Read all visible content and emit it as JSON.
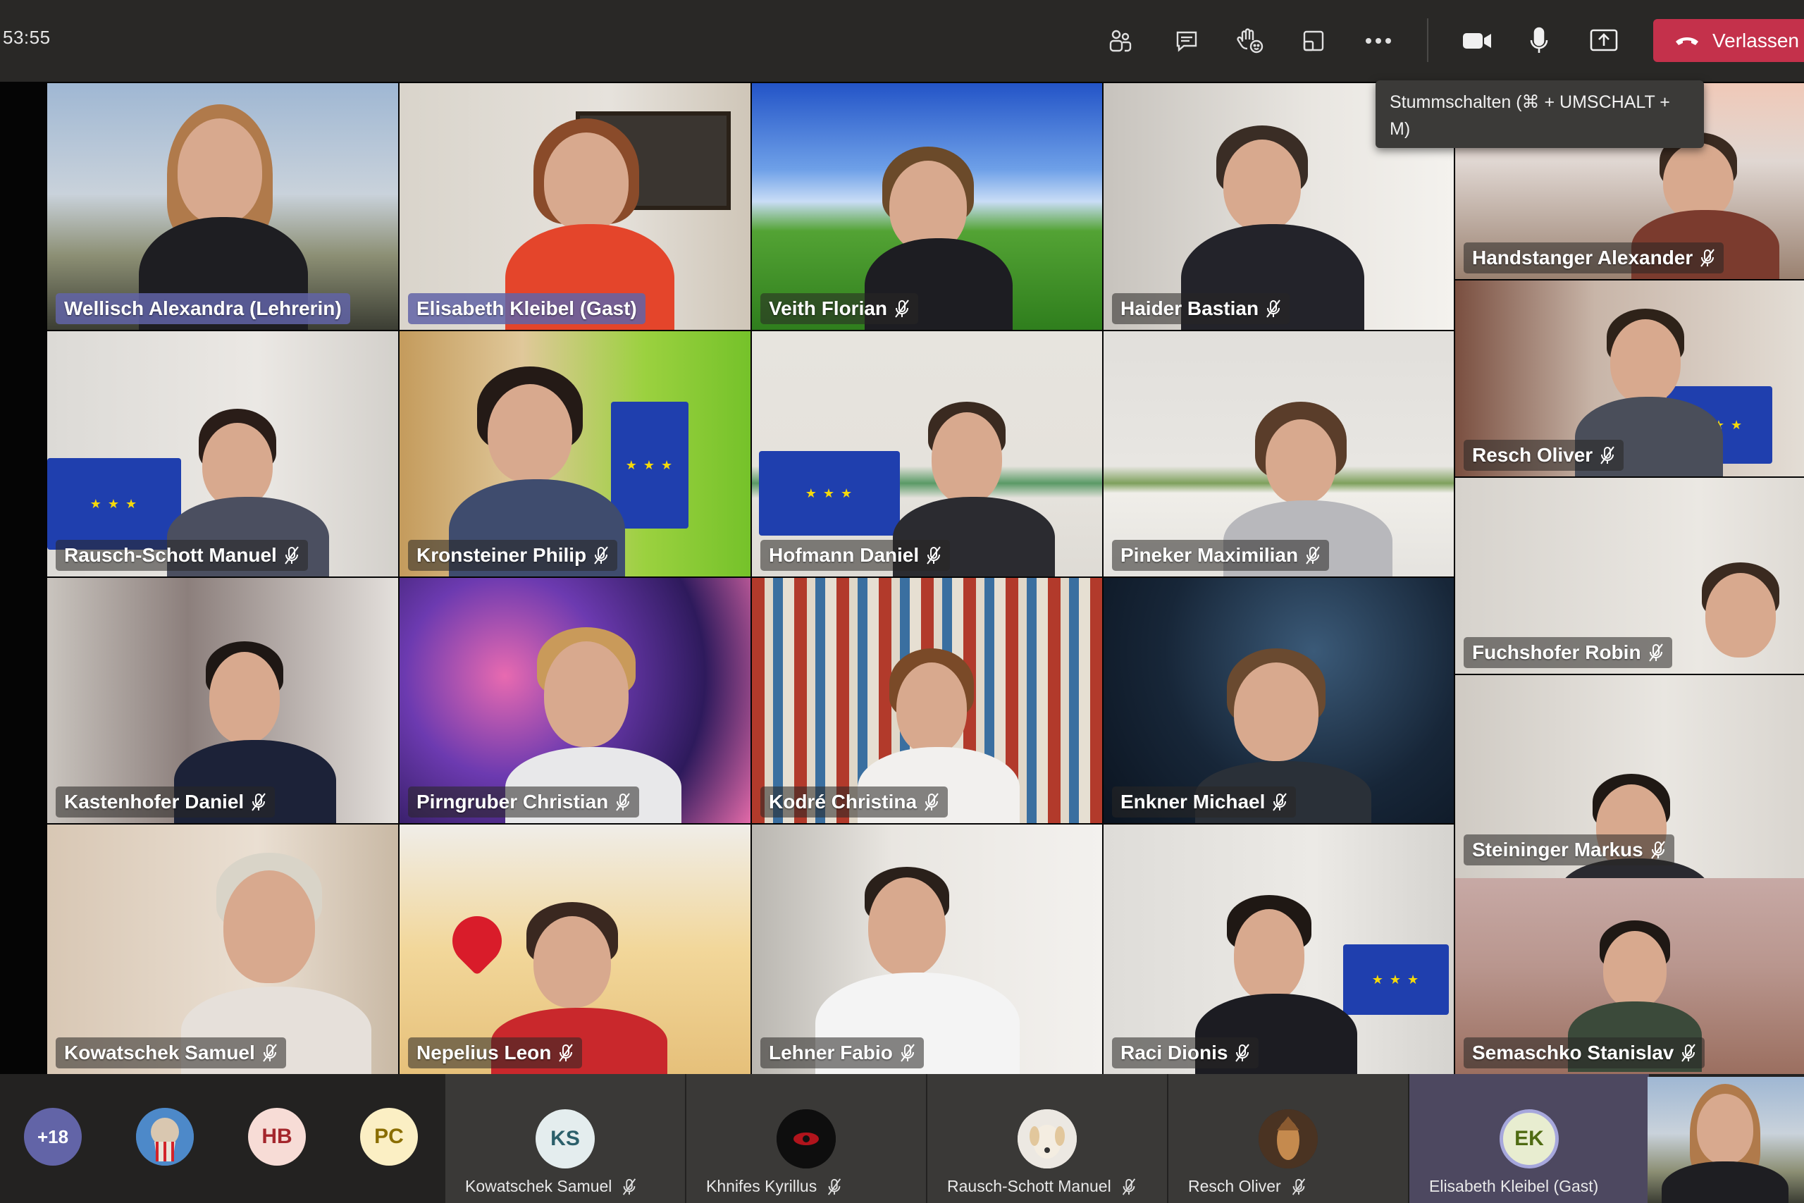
{
  "meeting": {
    "timer": "53:55",
    "leave_label": "Verlassen",
    "tooltip": "Stummschalten (⌘ + UMSCHALT + M)",
    "toolbar_icons": [
      "people-icon",
      "chat-icon",
      "raise-hand-icon",
      "rooms-icon",
      "more-icon",
      "camera-icon",
      "microphone-icon",
      "share-icon"
    ]
  },
  "tiles": [
    {
      "name": "Wellisch Alexandra (Lehrerin)",
      "host": true
    },
    {
      "name": "Elisabeth Kleibel (Gast)",
      "host": true
    },
    {
      "name": "Veith Florian"
    },
    {
      "name": "Haider Bastian"
    },
    {
      "name": "Handstanger Alexander"
    },
    {
      "name": "Rausch-Schott Manuel"
    },
    {
      "name": "Kronsteiner Philip"
    },
    {
      "name": "Hofmann Daniel"
    },
    {
      "name": "Pineker Maximilian"
    },
    {
      "name": "Resch Oliver"
    },
    {
      "name": "Fuchshofer Robin"
    },
    {
      "name": "Kastenhofer Daniel"
    },
    {
      "name": "Pirngruber Christian"
    },
    {
      "name": "Kodré Christina"
    },
    {
      "name": "Enkner Michael"
    },
    {
      "name": "Steininger Markus"
    },
    {
      "name": "Kowatschek Samuel"
    },
    {
      "name": "Nepelius Leon"
    },
    {
      "name": "Lehner Fabio"
    },
    {
      "name": "Raci Dionis"
    },
    {
      "name": "Semaschko Stanislav"
    }
  ],
  "bottom": {
    "overflow_count": "+18",
    "avatars": [
      {
        "initials": "HB",
        "color": "#f7dcd6",
        "text_color": "#a4262c"
      },
      {
        "initials": "PC",
        "color": "#fbefc4",
        "text_color": "#8a6d00"
      }
    ],
    "roster": [
      {
        "name": "Kowatschek Samuel",
        "initials": "KS"
      },
      {
        "name": "Khnifes Kyrillus",
        "initials": ""
      },
      {
        "name": "Rausch-Schott Manuel",
        "initials": ""
      },
      {
        "name": "Resch Oliver",
        "initials": ""
      },
      {
        "name": "Elisabeth Kleibel (Gast)",
        "initials": "EK"
      }
    ]
  },
  "colors": {
    "accent": "#6264a7",
    "leave": "#c4314b",
    "topbar": "#292826"
  }
}
